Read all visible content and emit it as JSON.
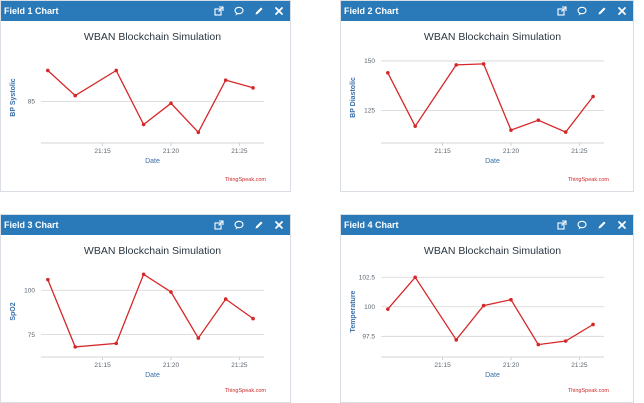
{
  "panels": [
    {
      "header": "Field 1 Chart",
      "credit": "ThingSpeak.com",
      "chart_data": {
        "type": "line",
        "title": "WBAN Blockchain Simulation",
        "xlabel": "Date",
        "ylabel": "BP Systolic",
        "x": [
          "21:11",
          "21:13",
          "21:16",
          "21:18",
          "21:20",
          "21:22",
          "21:24",
          "21:26"
        ],
        "values": [
          93,
          86.5,
          93,
          79,
          84.5,
          77,
          90.5,
          88.5
        ],
        "ylim": [
          75,
          97
        ],
        "yticks": [
          85
        ],
        "xticks": [
          "21:15",
          "21:20",
          "21:25"
        ],
        "grid": true,
        "color": "#d62728"
      }
    },
    {
      "header": "Field 2 Chart",
      "credit": "ThingSpeak.com",
      "chart_data": {
        "type": "line",
        "title": "WBAN Blockchain Simulation",
        "xlabel": "Date",
        "ylabel": "BP Diastolic",
        "x": [
          "21:11",
          "21:13",
          "21:16",
          "21:18",
          "21:20",
          "21:22",
          "21:24",
          "21:26"
        ],
        "values": [
          144,
          117,
          148,
          148.5,
          115,
          120,
          114,
          132
        ],
        "ylim": [
          110,
          153
        ],
        "yticks": [
          125,
          150
        ],
        "xticks": [
          "21:15",
          "21:20",
          "21:25"
        ],
        "grid": true,
        "color": "#d62728"
      }
    },
    {
      "header": "Field 3 Chart",
      "credit": "ThingSpeak.com",
      "chart_data": {
        "type": "line",
        "title": "WBAN Blockchain Simulation",
        "xlabel": "Date",
        "ylabel": "SpO2",
        "x": [
          "21:11",
          "21:13",
          "21:16",
          "21:18",
          "21:20",
          "21:22",
          "21:24",
          "21:26"
        ],
        "values": [
          106,
          68,
          70,
          109,
          99,
          73,
          95,
          84
        ],
        "ylim": [
          64,
          112
        ],
        "yticks": [
          75,
          100
        ],
        "xticks": [
          "21:15",
          "21:20",
          "21:25"
        ],
        "grid": true,
        "color": "#d62728"
      }
    },
    {
      "header": "Field 4 Chart",
      "credit": "ThingSpeak.com",
      "chart_data": {
        "type": "line",
        "title": "WBAN Blockchain Simulation",
        "xlabel": "Date",
        "ylabel": "Temperature",
        "x": [
          "21:11",
          "21:13",
          "21:16",
          "21:18",
          "21:20",
          "21:22",
          "21:24",
          "21:26"
        ],
        "values": [
          99.8,
          102.5,
          97.2,
          100.1,
          100.6,
          96.8,
          97.1,
          98.5
        ],
        "ylim": [
          96,
          103.2
        ],
        "yticks": [
          97.5,
          100,
          102.5
        ],
        "xticks": [
          "21:15",
          "21:20",
          "21:25"
        ],
        "grid": true,
        "color": "#d62728"
      }
    }
  ],
  "tool_icons": [
    "external-link-icon",
    "comment-icon",
    "pencil-icon",
    "close-icon"
  ],
  "colors": {
    "header": "#2a79b8",
    "line": "#d62728",
    "axis_label": "#3a6fa8",
    "grid": "#d4d4d4"
  }
}
